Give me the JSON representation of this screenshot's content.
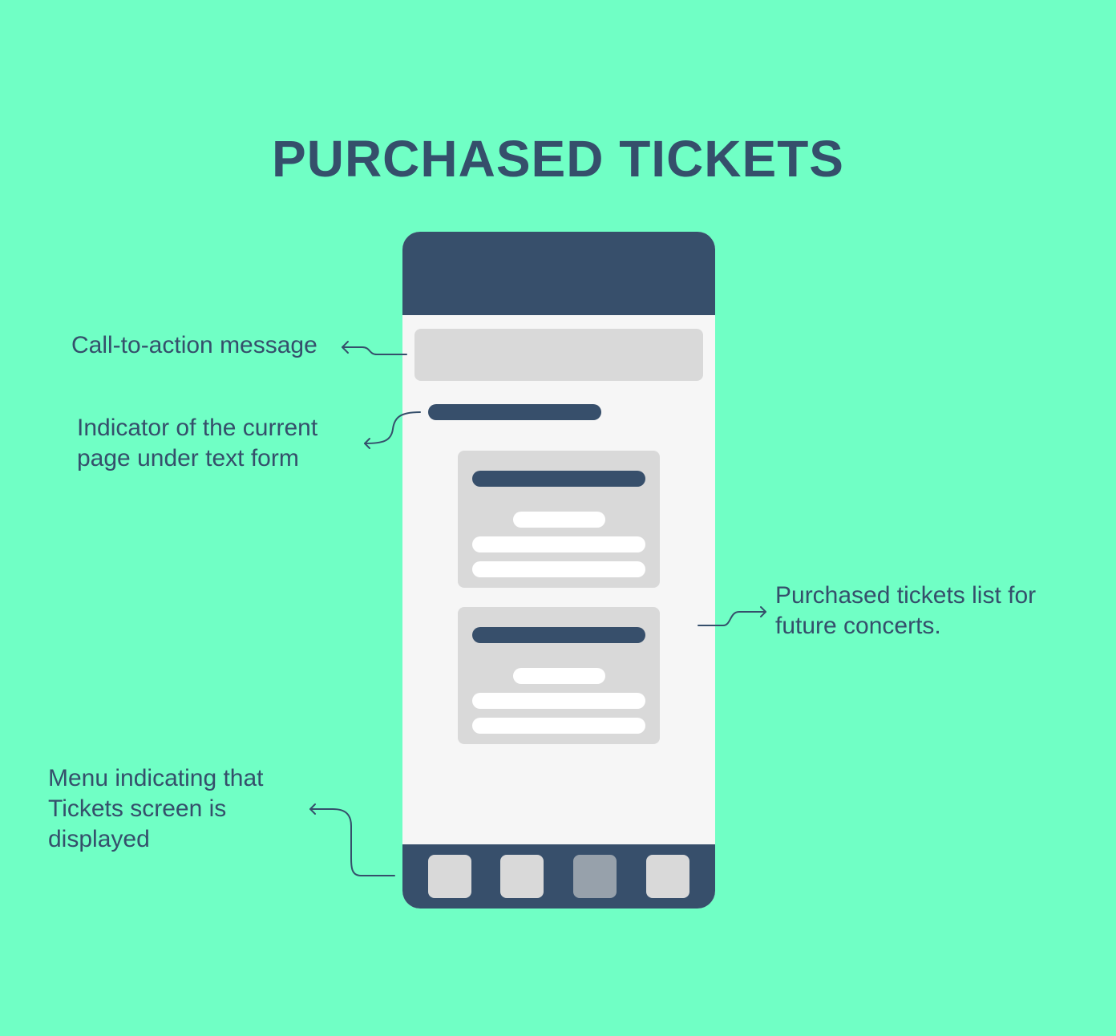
{
  "title": "PURCHASED TICKETS",
  "annotations": {
    "cta": "Call-to-action message",
    "indicator_line1": "Indicator of the current",
    "indicator_line2": "page under text form",
    "tickets_line1": "Purchased tickets list for",
    "tickets_line2": "future concerts.",
    "menu_line1": "Menu indicating that",
    "menu_line2": "Tickets screen is",
    "menu_line3": "displayed"
  },
  "colors": {
    "background": "#70FFC5",
    "dark": "#374F6B",
    "placeholder": "#D9D9D9",
    "screen": "#F6F6F6",
    "active_menu": "#97A1AB"
  },
  "menu": {
    "items": 4,
    "active_index": 2
  }
}
